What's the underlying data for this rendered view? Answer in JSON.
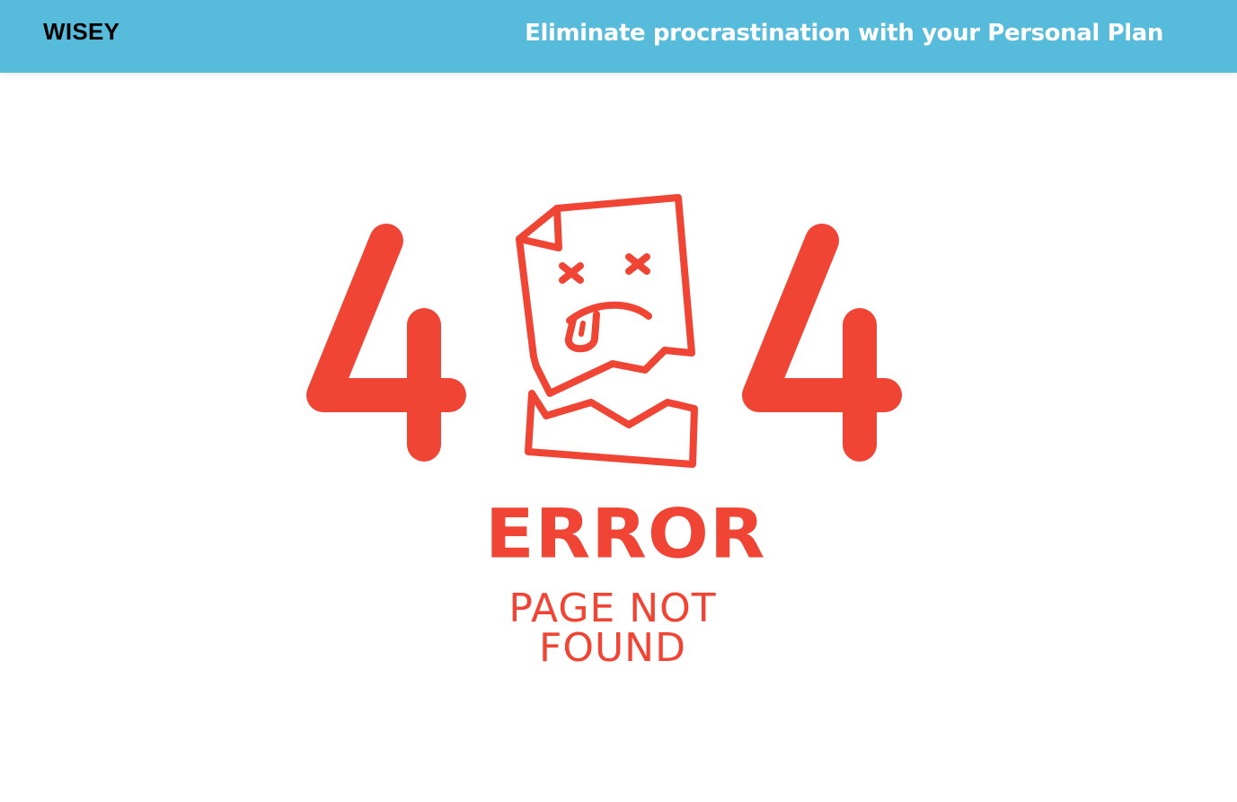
{
  "header": {
    "brand": "WISEY",
    "tagline": "Eliminate procrastination with your Personal Plan"
  },
  "error": {
    "code_left_digit": "4",
    "code_right_digit": "4",
    "title": "ERROR",
    "subtitle": "PAGE NOT FOUND"
  },
  "icons": {
    "illustration": "torn-page-dead-face-icon"
  },
  "colors": {
    "header_bg": "#57bbdb",
    "accent": "#f04435",
    "brand_text": "#000000",
    "tagline_text": "#ffffff"
  }
}
